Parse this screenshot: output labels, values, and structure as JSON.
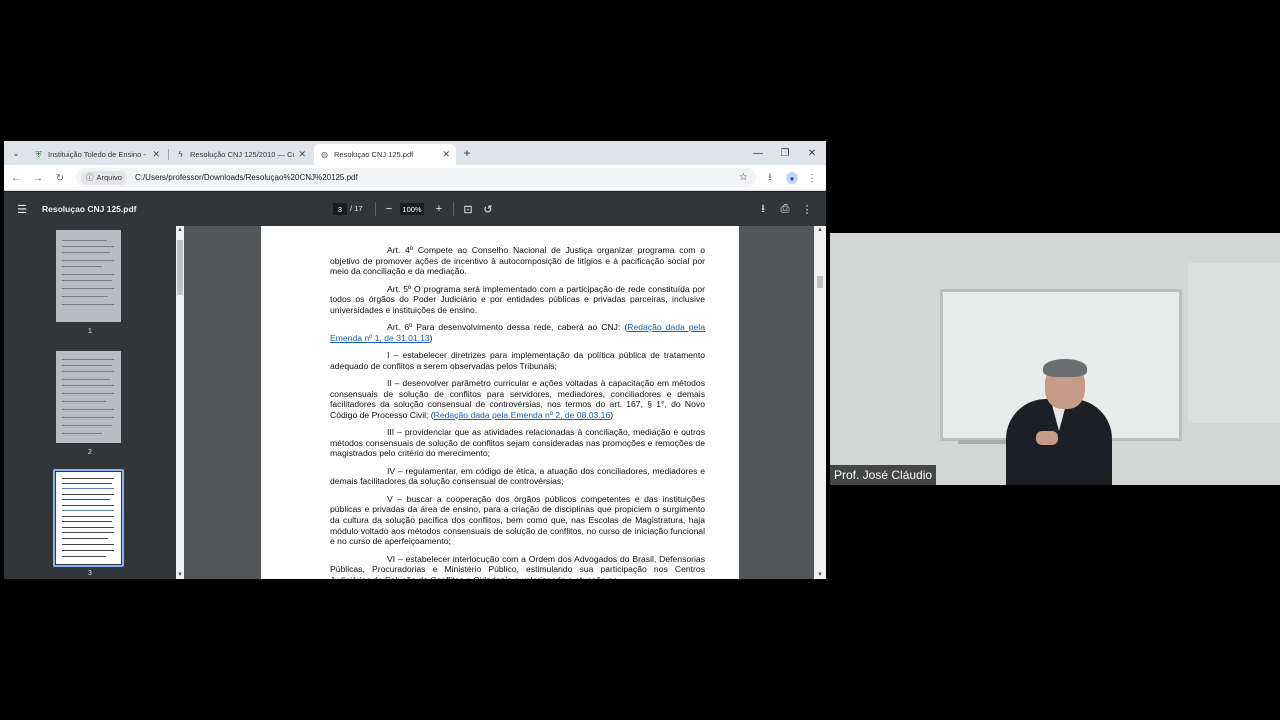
{
  "browser": {
    "tabs": [
      {
        "label": "Instituição Toledo de Ensino -",
        "icon": "shield-favicon-icon",
        "active": false
      },
      {
        "label": "Resolução CNJ 125/2010 — Co",
        "icon": "pulse-favicon-icon",
        "active": false
      },
      {
        "label": "Resoluçao CNJ 125.pdf",
        "icon": "globe-favicon-icon",
        "active": true
      }
    ],
    "address": {
      "chip_label": "Arquivo",
      "url": "C:/Users/professor/Downloads/Resoluçao%20CNJ%20125.pdf"
    }
  },
  "pdf_viewer": {
    "title": "Resoluçao CNJ 125.pdf",
    "current_page": "3",
    "total_pages": "/ 17",
    "zoom": "100%",
    "thumbnails": [
      {
        "number": "1"
      },
      {
        "number": "2"
      },
      {
        "number": "3"
      }
    ],
    "selected_thumbnail": "3"
  },
  "document": {
    "paragraphs": [
      {
        "text": "Art. 4º Compete ao Conselho Nacional de Justiça organizar programa com o objetivo de promover ações de incentivo à autocomposição de litígios e à pacificação social por meio da conciliação e da mediação."
      },
      {
        "text": "Art. 5º O programa será implementado com a participação de rede constituída por todos os órgãos do Poder Judiciário e por entidades públicas e privadas parceiras, inclusive universidades e instituições de ensino."
      },
      {
        "text": "Art. 6º Para desenvolvimento dessa rede, caberá ao CNJ: (",
        "link": "Redação dada pela Emenda nº 1, de 31.01.13",
        "after": ")"
      },
      {
        "text": "I – estabelecer diretrizes para implementação da política pública de tratamento adequado de conflitos a serem observadas pelos Tribunais;"
      },
      {
        "text": "II – desenvolver parâmetro curricular e ações voltadas à capacitação em métodos consensuais de solução de conflitos para servidores, mediadores, conciliadores e demais facilitadores da solução consensual de controvérsias, nos termos do art. 167, § 1°, do Novo Código de Processo Civil; (",
        "link": "Redação dada pela Emenda nº 2, de 08.03.16",
        "after": ")"
      },
      {
        "text": "III – providenciar que as atividades relacionadas à conciliação, mediação e outros métodos consensuais de solução de conflitos sejam consideradas nas promoções e remoções de magistrados pelo critério do merecimento;"
      },
      {
        "text": "IV – regulamentar, em código de ética, a atuação dos conciliadores, mediadores e demais facilitadores da solução consensual de controvérsias;"
      },
      {
        "text": "V – buscar a cooperação dos órgãos públicos competentes e das instituições públicas e privadas da área de ensino, para a criação de disciplinas que propiciem o surgimento da cultura da solução pacífica dos conflitos, bem como que, nas Escolas de Magistratura, haja módulo voltado aos métodos consensuais de solução de conflitos, no curso de iniciação funcional e no curso de aperfeiçoamento;"
      },
      {
        "text": "VI – estabelecer interlocução com a Ordem dos Advogados do Brasil, Defensorias Públicas, Procuradorias e Ministério Público, estimulando sua participação nos Centros Judiciários de Solução de Conflitos e Cidadania e valorizando a atuação na"
      }
    ]
  },
  "webcam": {
    "presenter_name": "Prof. José Cláudio"
  }
}
